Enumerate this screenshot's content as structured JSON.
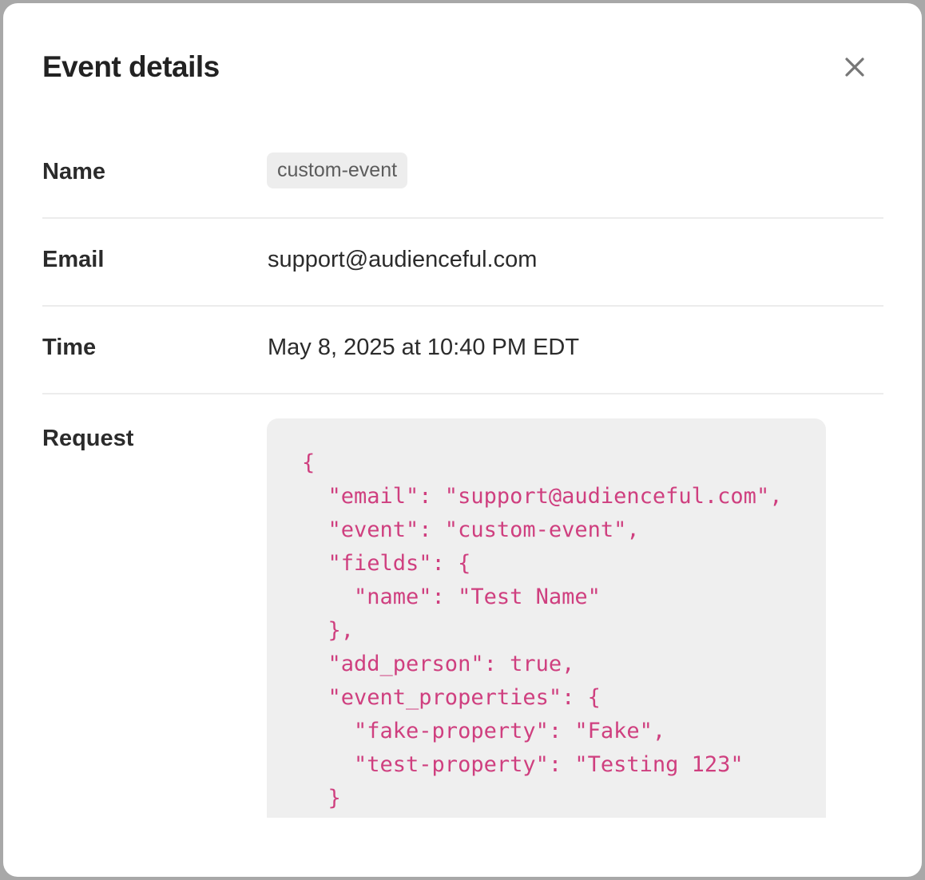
{
  "modal": {
    "title": "Event details",
    "close_icon": "close-icon"
  },
  "details": {
    "name": {
      "label": "Name",
      "value": "custom-event"
    },
    "email": {
      "label": "Email",
      "value": "support@audienceful.com"
    },
    "time": {
      "label": "Time",
      "value": "May 8, 2025 at 10:40 PM EDT"
    },
    "request": {
      "label": "Request",
      "code": "{\n  \"email\": \"support@audienceful.com\",\n  \"event\": \"custom-event\",\n  \"fields\": {\n    \"name\": \"Test Name\"\n  },\n  \"add_person\": true,\n  \"event_properties\": {\n    \"fake-property\": \"Fake\",\n    \"test-property\": \"Testing 123\"\n  }\n}"
    }
  },
  "colors": {
    "code_text": "#cf3f7f",
    "code_background": "#efefef",
    "badge_background": "#ededed",
    "backdrop": "#a8a8a8"
  }
}
